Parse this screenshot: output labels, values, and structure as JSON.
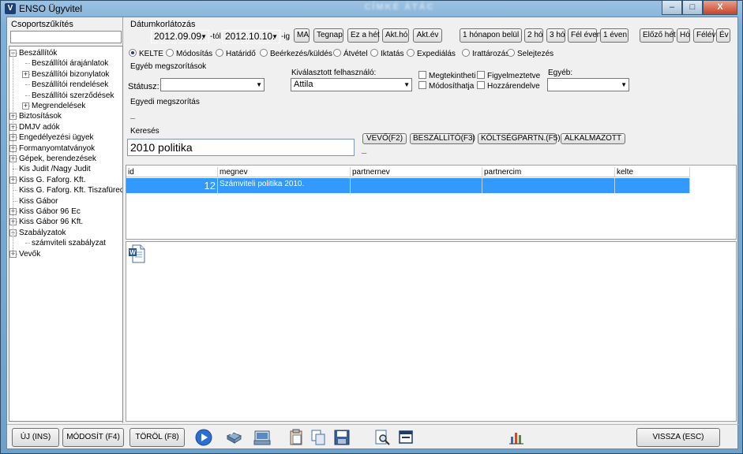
{
  "window": {
    "title": "ENSO Ügyvitel",
    "app_icon": "ENSO logo",
    "ghost_title": "CÍMKÉ ÁTÁC",
    "controls": {
      "minimize": "–",
      "maximize": "□",
      "close": "X"
    }
  },
  "left": {
    "group_label": "Csoportszűkítés",
    "group_filter_value": "",
    "tree": [
      {
        "label": "Beszállítók",
        "level": 0,
        "toggle": "−"
      },
      {
        "label": "Beszállítói árajánlatok",
        "level": 1,
        "toggle": ""
      },
      {
        "label": "Beszállítói bizonylatok",
        "level": 1,
        "toggle": "+"
      },
      {
        "label": "Beszállítói rendelések",
        "level": 1,
        "toggle": ""
      },
      {
        "label": "Beszállítói szerződések",
        "level": 1,
        "toggle": ""
      },
      {
        "label": "Megrendelések",
        "level": 1,
        "toggle": "+"
      },
      {
        "label": "Biztosítások",
        "level": 0,
        "toggle": "+"
      },
      {
        "label": "DMJV adók",
        "level": 0,
        "toggle": "+"
      },
      {
        "label": "Engedélyezési ügyek",
        "level": 0,
        "toggle": "+"
      },
      {
        "label": "Formanyomtatványok",
        "level": 0,
        "toggle": "+"
      },
      {
        "label": "Gépek, berendezések",
        "level": 0,
        "toggle": "+"
      },
      {
        "label": "Kis Judit /Nagy Judit",
        "level": 0,
        "toggle": ""
      },
      {
        "label": "Kiss G. Faforg. Kft.",
        "level": 0,
        "toggle": "+"
      },
      {
        "label": "Kiss G. Faforg. Kft. Tiszafüred",
        "level": 0,
        "toggle": ""
      },
      {
        "label": "Kiss Gábor",
        "level": 0,
        "toggle": ""
      },
      {
        "label": "Kiss Gábor 96 Ec",
        "level": 0,
        "toggle": "+"
      },
      {
        "label": "Kiss Gábor 96 Kft.",
        "level": 0,
        "toggle": "+"
      },
      {
        "label": "Szabályzatok",
        "level": 0,
        "toggle": "−"
      },
      {
        "label": "számviteli szabályzat",
        "level": 1,
        "toggle": ""
      },
      {
        "label": "Vevők",
        "level": 0,
        "toggle": "+"
      }
    ]
  },
  "filters": {
    "date_label": "Dátumkorlátozás",
    "date_from": "2012.09.09.",
    "from_suffix": "-tól",
    "date_to": "2012.10.10.",
    "to_suffix": "-ig",
    "quick_buttons": [
      "MA",
      "Tegnap",
      "Ez a hét",
      "Akt.hó",
      "Akt.év"
    ],
    "range_buttons": [
      "1 hónapon belül",
      "2 hó",
      "3 hó",
      "Fél éven",
      "1 éven"
    ],
    "prev_buttons": [
      "Előző hét",
      "Hó",
      "Félév",
      "Év"
    ],
    "date_types": [
      {
        "label": "KELTE",
        "selected": true
      },
      {
        "label": "Módosítás",
        "selected": false
      },
      {
        "label": "Határidő",
        "selected": false
      },
      {
        "label": "Beérkezés/küldés",
        "selected": false
      },
      {
        "label": "Átvétel",
        "selected": false
      },
      {
        "label": "Iktatás",
        "selected": false
      },
      {
        "label": "Expediálás",
        "selected": false
      },
      {
        "label": "Irattározás",
        "selected": false
      },
      {
        "label": "Selejtezés",
        "selected": false
      }
    ],
    "other_label": "Egyéb megszorítások",
    "status_label": "Státusz:",
    "status_value": "",
    "user_label": "Kiválasztott felhasználó:",
    "user_value": "Attila",
    "checks": [
      "Megtekintheti",
      "Módosíthatja",
      "Figyelmeztetve",
      "Hozzárendelve"
    ],
    "egyeb_label": "Egyéb:",
    "egyeb_value": "",
    "custom_label": "Egyedi megszorítás",
    "dash1": "_",
    "dash2": "_"
  },
  "search": {
    "label": "Keresés",
    "value": "2010 politika",
    "buttons": [
      "VEVŐ(F2)",
      "BESZÁLLÍTÓ(F3)",
      "KÖLTSÉGPARTN.(F5)",
      "ALKALMAZOTT"
    ]
  },
  "grid": {
    "columns": [
      "id",
      "megnev",
      "partnernev",
      "partnercim",
      "kelte"
    ],
    "rows": [
      {
        "id": "12",
        "megnev": "Számviteli politika 2010.",
        "partnernev": "",
        "partnercim": "",
        "kelte": ""
      }
    ]
  },
  "detail": {
    "attachment_icon": "word-document-icon"
  },
  "bottom": {
    "new_btn": "ÚJ (INS)",
    "edit_btn": "MÓDOSÍT (F4)",
    "delete_btn": "TÖRÖL (F8)",
    "back_btn": "VISSZA (ESC)"
  },
  "colors": {
    "selection": "#3399ff",
    "title_icon": "#1d3f73"
  }
}
